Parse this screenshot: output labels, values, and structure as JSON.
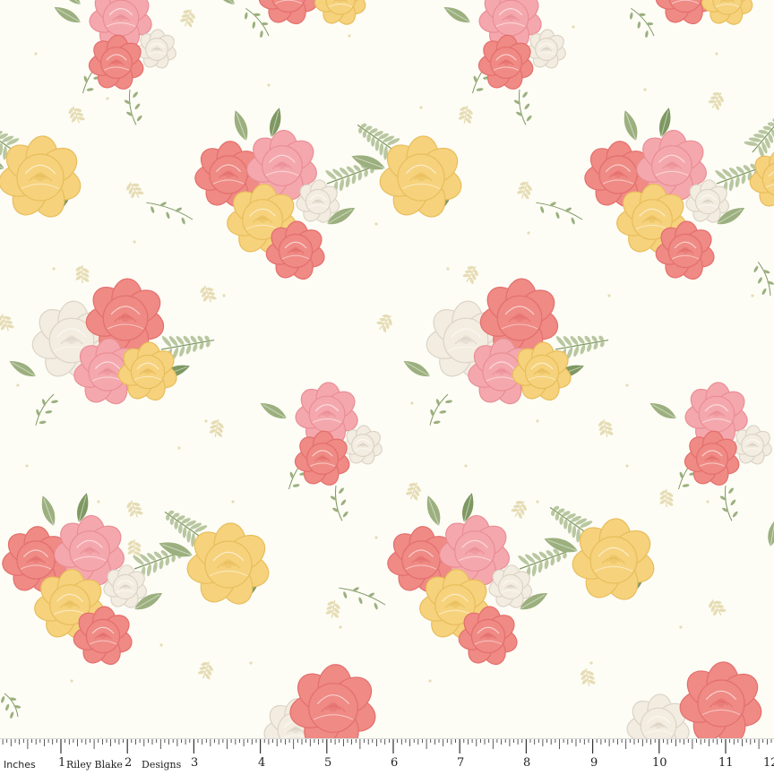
{
  "palette": {
    "background": "#fdfdf6",
    "coral": "#ef8a84",
    "coral_dark": "#e46f6d",
    "pink": "#f4a8ad",
    "pink_light": "#f7bfc2",
    "yellow": "#f6d27c",
    "yellow_dark": "#e8bd5c",
    "cream": "#f3ede1",
    "cream_shadow": "#dcd3c6",
    "leaf": "#9cb07f",
    "leaf_dark": "#7f9862",
    "fern": "#b9c7a1",
    "speck": "#e6dcb4"
  },
  "ruler": {
    "unit_label": "Inches",
    "brand_left": "Riley Blake",
    "brand_right": "Designs",
    "numbers": [
      "1",
      "2",
      "3",
      "4",
      "5",
      "6",
      "7",
      "8",
      "9",
      "10",
      "11",
      "12"
    ]
  }
}
